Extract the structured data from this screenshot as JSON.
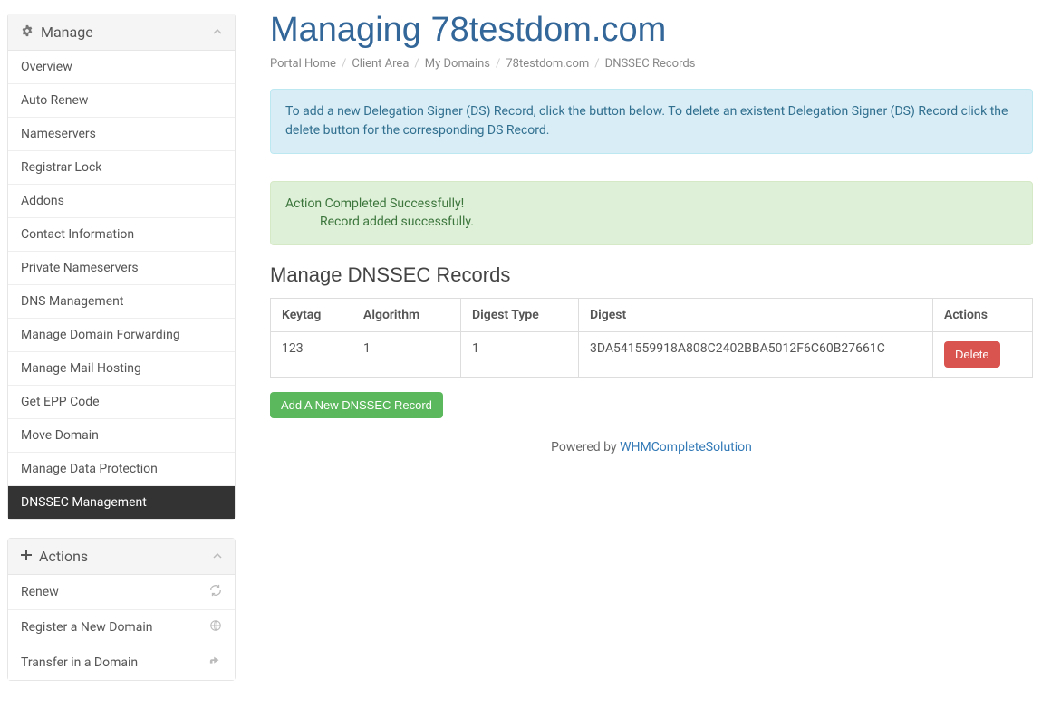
{
  "sidebar": {
    "manage": {
      "title": "Manage",
      "items": [
        {
          "label": "Overview"
        },
        {
          "label": "Auto Renew"
        },
        {
          "label": "Nameservers"
        },
        {
          "label": "Registrar Lock"
        },
        {
          "label": "Addons"
        },
        {
          "label": "Contact Information"
        },
        {
          "label": "Private Nameservers"
        },
        {
          "label": "DNS Management"
        },
        {
          "label": "Manage Domain Forwarding"
        },
        {
          "label": "Manage Mail Hosting"
        },
        {
          "label": "Get EPP Code"
        },
        {
          "label": "Move Domain"
        },
        {
          "label": "Manage Data Protection"
        },
        {
          "label": "DNSSEC Management",
          "active": true
        }
      ]
    },
    "actions": {
      "title": "Actions",
      "items": [
        {
          "label": "Renew",
          "icon": "refresh"
        },
        {
          "label": "Register a New Domain",
          "icon": "globe"
        },
        {
          "label": "Transfer in a Domain",
          "icon": "share"
        }
      ]
    }
  },
  "page": {
    "title": "Managing 78testdom.com",
    "breadcrumb": [
      "Portal Home",
      "Client Area",
      "My Domains",
      "78testdom.com",
      "DNSSEC Records"
    ],
    "info_alert": "To add a new Delegation Signer (DS) Record, click the button below. To delete an existent Delegation Signer (DS) Record click the delete button for the corresponding DS Record.",
    "success_alert": {
      "title": "Action Completed Successfully!",
      "message": "Record added successfully."
    },
    "section_title": "Manage DNSSEC Records",
    "table": {
      "headers": [
        "Keytag",
        "Algorithm",
        "Digest Type",
        "Digest",
        "Actions"
      ],
      "rows": [
        {
          "keytag": "123",
          "algorithm": "1",
          "digest_type": "1",
          "digest": "3DA541559918A808C2402BBA5012F6C60B27661C",
          "action": "Delete"
        }
      ]
    },
    "add_button": "Add A New DNSSEC Record",
    "footer": {
      "prefix": "Powered by ",
      "link": "WHMCompleteSolution"
    }
  }
}
